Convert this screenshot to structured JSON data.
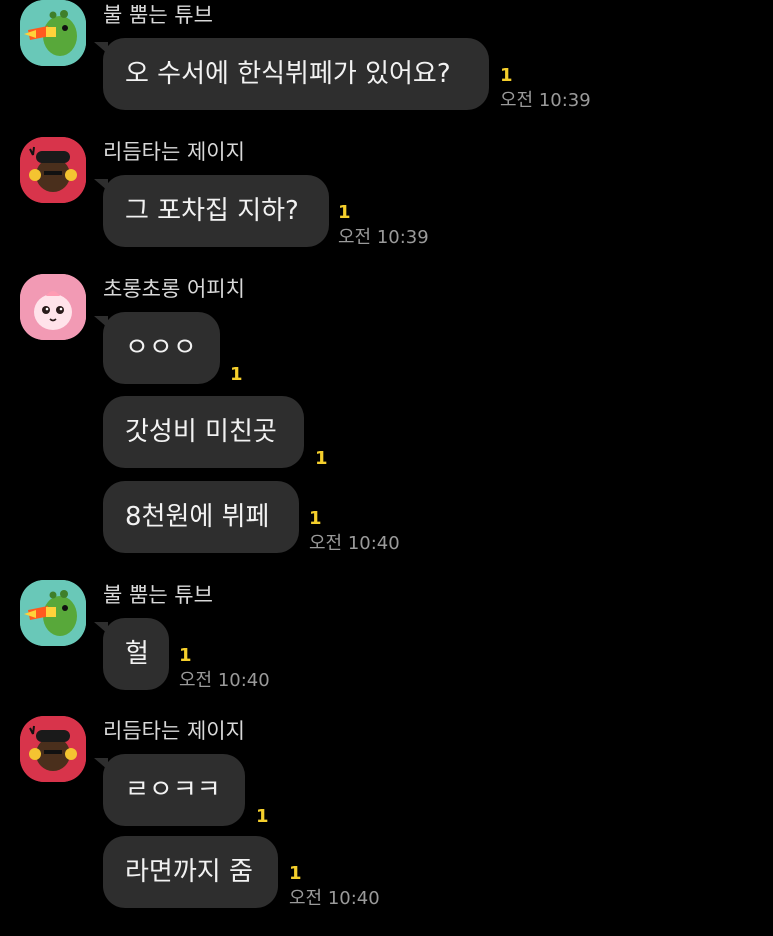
{
  "chat": {
    "messages": [
      {
        "sender": "불 뿜는 튜브",
        "avatar_icon": "tube-fire-breathing-icon",
        "bubbles": [
          {
            "text": "오 수서에 한식뷔페가 있어요?",
            "unread": "1",
            "time": "오전 10:39"
          }
        ]
      },
      {
        "sender": "리듬타는 제이지",
        "avatar_icon": "jay-g-headphones-icon",
        "bubbles": [
          {
            "text": "그 포차집 지하?",
            "unread": "1",
            "time": "오전 10:39"
          }
        ]
      },
      {
        "sender": "초롱초롱 어피치",
        "avatar_icon": "apeach-sparkly-eyes-icon",
        "bubbles": [
          {
            "text": "ㅇㅇㅇ",
            "unread": "1"
          },
          {
            "text": "갓성비 미친곳",
            "unread": "1"
          },
          {
            "text": "8천원에 뷔페",
            "unread": "1",
            "time": "오전 10:40"
          }
        ]
      },
      {
        "sender": "불 뿜는 튜브",
        "avatar_icon": "tube-fire-breathing-icon",
        "bubbles": [
          {
            "text": "헐",
            "unread": "1",
            "time": "오전 10:40"
          }
        ]
      },
      {
        "sender": "리듬타는 제이지",
        "avatar_icon": "jay-g-headphones-icon",
        "bubbles": [
          {
            "text": "ㄹㅇㅋㅋ",
            "unread": "1"
          },
          {
            "text": "라면까지 줌",
            "unread": "1",
            "time": "오전 10:40"
          }
        ]
      }
    ]
  },
  "colors": {
    "background": "#000000",
    "bubble": "#2e2e2e",
    "unread": "#f5cf2c",
    "time": "#9a9a9a",
    "tube_avatar_bg": "#69c8b8",
    "jayg_avatar_bg": "#d8344b",
    "apeach_avatar_bg": "#f29ab4"
  }
}
